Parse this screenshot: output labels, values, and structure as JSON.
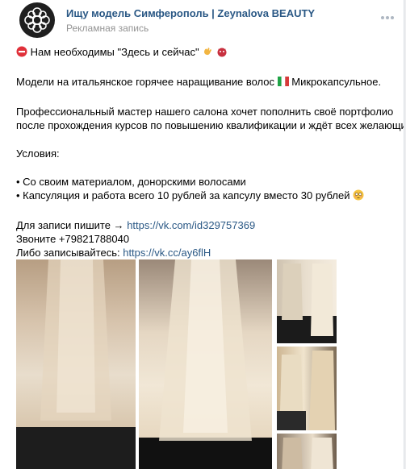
{
  "post": {
    "author": "Ищу модель Симферополь | Zeynalova BEAUTY",
    "subtitle": "Рекламная запись",
    "lines": {
      "l1": "Нам необходимы \"Здесь и сейчас\"",
      "l2": "Модели на итальянское горячее наращивание волос",
      "l2b": "Микрокапсульное.",
      "l3": "Профессиональный мастер нашего салона хочет пополнить своё портфолио",
      "l4": "после прохождения курсов по повышению квалификации и ждёт всех желающих!",
      "l5": "Условия:",
      "l6": "• Со своим материалом, донорскими волосами",
      "l7": "• Капсуляция и работа всего 10 рублей за капсулу вместо 30 рублей",
      "l8": "Для записи пишите →",
      "l8_link": "https://vk.com/id329757369",
      "l9": "Звоните +79821788040",
      "l10": "Либо записывайтесь:",
      "l10_link": "https://vk.cc/ay6flH"
    }
  },
  "icons": {
    "stop": "no-entry-icon",
    "hand": "ok-hand-icon",
    "face": "devil-face-icon",
    "flag": "italy-flag-icon",
    "smile": "flushed-face-icon",
    "more": "more-dots-icon",
    "avatar": "salon-logo-icon"
  },
  "colors": {
    "link": "#2a5885",
    "muted": "#939393"
  }
}
